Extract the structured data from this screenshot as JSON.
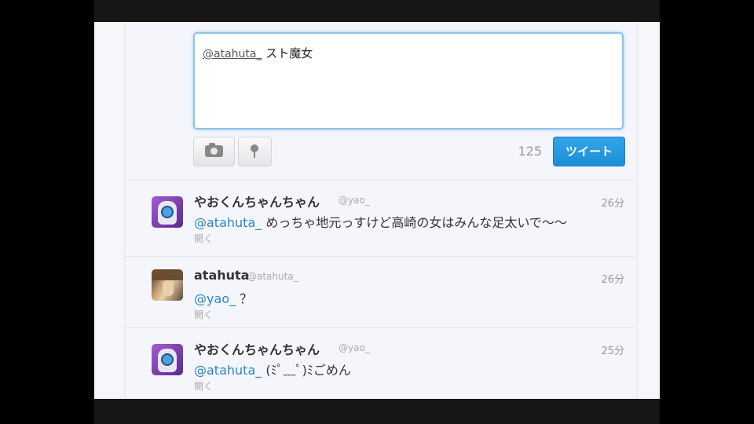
{
  "composer": {
    "mention": "@atahuta_",
    "text": " スト魔女",
    "counter": "125",
    "tweet_button": "ツイート",
    "camera_icon": "camera-icon",
    "location_icon": "location-pin-icon"
  },
  "tweets": [
    {
      "name": "やおくんちゃんちゃん",
      "handle": "@yao_",
      "time": "26分",
      "mention": "@atahuta_",
      "text": " めっちゃ地元っすけど高崎の女はみんな足太いで〜〜",
      "expand": "開く",
      "avatar": "anime-avatar"
    },
    {
      "name": "atahuta",
      "handle": "@atahuta_",
      "time": "26分",
      "mention": "@yao_",
      "text": " ？",
      "expand": "開く",
      "avatar": "photo-avatar"
    },
    {
      "name": "やおくんちゃんちゃん",
      "handle": "@yao_",
      "time": "25分",
      "mention": "@atahuta_",
      "text": " (ﾐﾟ﹏ﾟ)ﾐごめん",
      "expand": "開く",
      "avatar": "anime-avatar"
    }
  ],
  "colors": {
    "accent": "#1d8ed8",
    "mention": "#2a86c9",
    "focus_border": "#8ec3ea"
  }
}
